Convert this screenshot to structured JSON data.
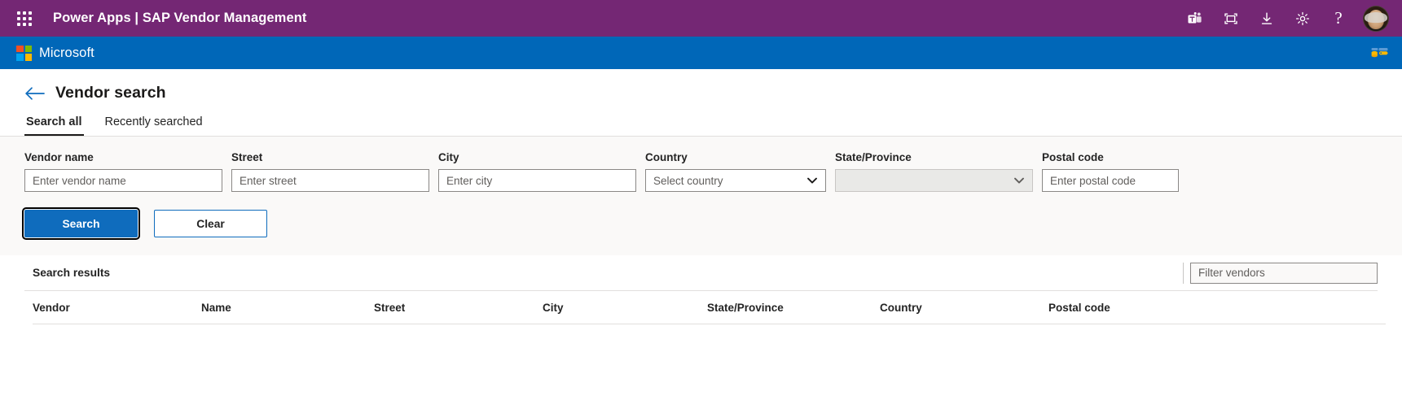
{
  "topbar": {
    "waffle_icon": "app-launcher-icon",
    "product": "Power Apps",
    "separator": "|",
    "app_name": "SAP Vendor Management",
    "title_full": "Power Apps  |  SAP Vendor Management",
    "icons": [
      {
        "name": "teams-icon",
        "label": "Open in Teams"
      },
      {
        "name": "fullscreen-icon",
        "label": "Full screen"
      },
      {
        "name": "download-icon",
        "label": "Download"
      },
      {
        "name": "gear-icon",
        "label": "Settings"
      },
      {
        "name": "help-icon",
        "label": "?"
      }
    ],
    "avatar": "user-avatar",
    "background_color": "#742774"
  },
  "msbar": {
    "brand": "Microsoft",
    "logo": "microsoft-logo",
    "right_icon": "data-connection-icon",
    "background_color": "#0067b8",
    "logo_colors": [
      "#f25022",
      "#7fba00",
      "#00a4ef",
      "#ffb900"
    ]
  },
  "page": {
    "back_icon": "back-arrow-icon",
    "title": "Vendor search"
  },
  "tabs": [
    {
      "label": "Search all",
      "active": true
    },
    {
      "label": "Recently searched",
      "active": false
    }
  ],
  "search_form": {
    "fields": [
      {
        "label": "Vendor name",
        "placeholder": "Enter vendor name",
        "type": "text",
        "value": "",
        "name": "vendor-name"
      },
      {
        "label": "Street",
        "placeholder": "Enter street",
        "type": "text",
        "value": "",
        "name": "street"
      },
      {
        "label": "City",
        "placeholder": "Enter city",
        "type": "text",
        "value": "",
        "name": "city"
      },
      {
        "label": "Country",
        "placeholder": "Select country",
        "type": "select",
        "value": "",
        "disabled": false,
        "name": "country"
      },
      {
        "label": "State/Province",
        "placeholder": "",
        "type": "select",
        "value": "",
        "disabled": true,
        "name": "state-province"
      },
      {
        "label": "Postal code",
        "placeholder": "Enter postal code",
        "type": "text",
        "value": "",
        "name": "postal-code"
      }
    ],
    "buttons": {
      "search_label": "Search",
      "clear_label": "Clear",
      "primary_color": "#0f6cbd"
    }
  },
  "results": {
    "title": "Search results",
    "filter_placeholder": "Filter vendors",
    "filter_value": "",
    "columns": [
      "Vendor",
      "Name",
      "Street",
      "City",
      "State/Province",
      "Country",
      "Postal code"
    ],
    "rows": []
  }
}
